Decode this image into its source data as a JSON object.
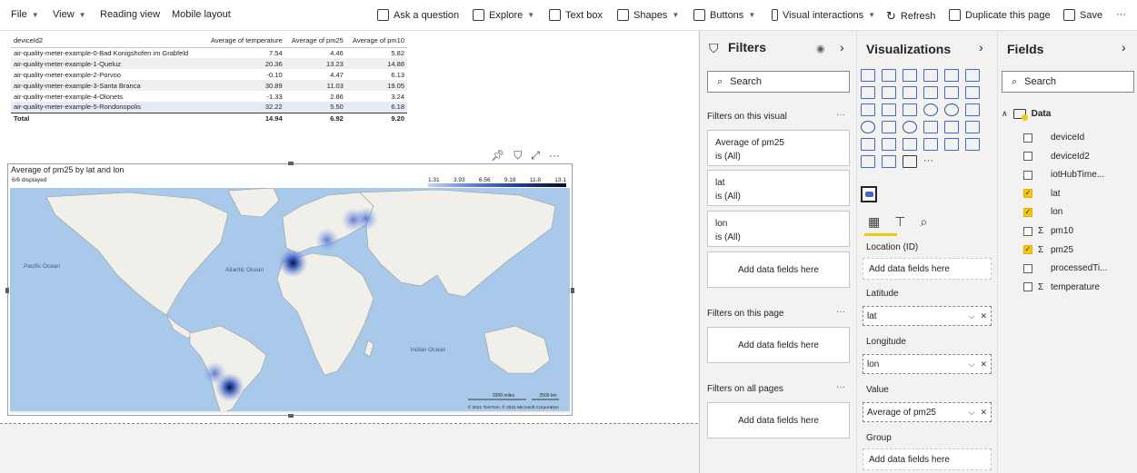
{
  "toolbar": {
    "file": "File",
    "view": "View",
    "reading_view": "Reading view",
    "mobile_layout": "Mobile layout",
    "ask_question": "Ask a question",
    "explore": "Explore",
    "text_box": "Text box",
    "shapes": "Shapes",
    "buttons": "Buttons",
    "visual_interactions": "Visual interactions",
    "refresh": "Refresh",
    "duplicate_page": "Duplicate this page",
    "save": "Save",
    "more": "···"
  },
  "table": {
    "headers": [
      "deviceId2",
      "Average of temperature",
      "Average of pm25",
      "Average of pm10"
    ],
    "rows": [
      [
        "air-quality-meter-example-0-Bad Konigshofen im Grabfeld",
        "7.54",
        "4.46",
        "5.82"
      ],
      [
        "air-quality-meter-example-1-Queluz",
        "20.36",
        "13.23",
        "14.88"
      ],
      [
        "air-quality-meter-example-2-Porvoo",
        "-0.10",
        "4.47",
        "6.13"
      ],
      [
        "air-quality-meter-example-3-Santa Branca",
        "30.89",
        "11.03",
        "19.05"
      ],
      [
        "air-quality-meter-example-4-Olonets",
        "-1.33",
        "2.86",
        "3.24"
      ],
      [
        "air-quality-meter-example-5-Rondonopolis",
        "32.22",
        "5.50",
        "6.18"
      ]
    ],
    "total": [
      "Total",
      "14.94",
      "6.92",
      "9.20"
    ]
  },
  "map": {
    "title": "Average of pm25 by lat and lon",
    "subtitle": "6/6 displayed",
    "legend": [
      "1.31",
      "3.93",
      "6.56",
      "9.18",
      "11.8",
      "13.1"
    ],
    "labels": {
      "pacific": "Pacific Ocean",
      "atlantic": "Atlantic Ocean",
      "indian": "Indian Ocean"
    },
    "scale_miles": "2000 miles",
    "scale_km": "2500 km",
    "copyright": "© 2021 TomTom, © 2021 Microsoft Corporation",
    "points": [
      {
        "name": "Bad Konigshofen im Grabfeld",
        "lat": 50.3,
        "lon": 10.5,
        "pm25": 4.46
      },
      {
        "name": "Queluz",
        "lat": 38.8,
        "lon": -9.3,
        "pm25": 13.23
      },
      {
        "name": "Porvoo",
        "lat": 60.4,
        "lon": 25.7,
        "pm25": 4.47
      },
      {
        "name": "Santa Branca",
        "lat": -23.4,
        "lon": -45.9,
        "pm25": 11.03
      },
      {
        "name": "Olonets",
        "lat": 61.0,
        "lon": 33.0,
        "pm25": 2.86
      },
      {
        "name": "Rondonopolis",
        "lat": -16.5,
        "lon": -54.6,
        "pm25": 5.5
      }
    ]
  },
  "filters": {
    "title": "Filters",
    "search": "Search",
    "on_visual": "Filters on this visual",
    "on_page": "Filters on this page",
    "on_all": "Filters on all pages",
    "cards": [
      {
        "name": "Average of pm25",
        "state": "is (All)"
      },
      {
        "name": "lat",
        "state": "is (All)"
      },
      {
        "name": "lon",
        "state": "is (All)"
      }
    ],
    "add_here": "Add data fields here"
  },
  "viz": {
    "title": "Visualizations",
    "wells": {
      "location": "Location (ID)",
      "latitude": "Latitude",
      "longitude": "Longitude",
      "value": "Value",
      "group": "Group"
    },
    "latitude_field": "lat",
    "longitude_field": "lon",
    "value_field": "Average of pm25",
    "add_here": "Add data fields here"
  },
  "fields": {
    "title": "Fields",
    "search": "Search",
    "table": "Data",
    "items": [
      {
        "name": "deviceId",
        "checked": false,
        "sigma": false
      },
      {
        "name": "deviceId2",
        "checked": false,
        "sigma": false
      },
      {
        "name": "iotHubTime...",
        "checked": false,
        "sigma": false
      },
      {
        "name": "lat",
        "checked": true,
        "sigma": false
      },
      {
        "name": "lon",
        "checked": true,
        "sigma": false
      },
      {
        "name": "pm10",
        "checked": false,
        "sigma": true
      },
      {
        "name": "pm25",
        "checked": true,
        "sigma": true
      },
      {
        "name": "processedTi...",
        "checked": false,
        "sigma": false
      },
      {
        "name": "temperature",
        "checked": false,
        "sigma": true
      }
    ]
  }
}
